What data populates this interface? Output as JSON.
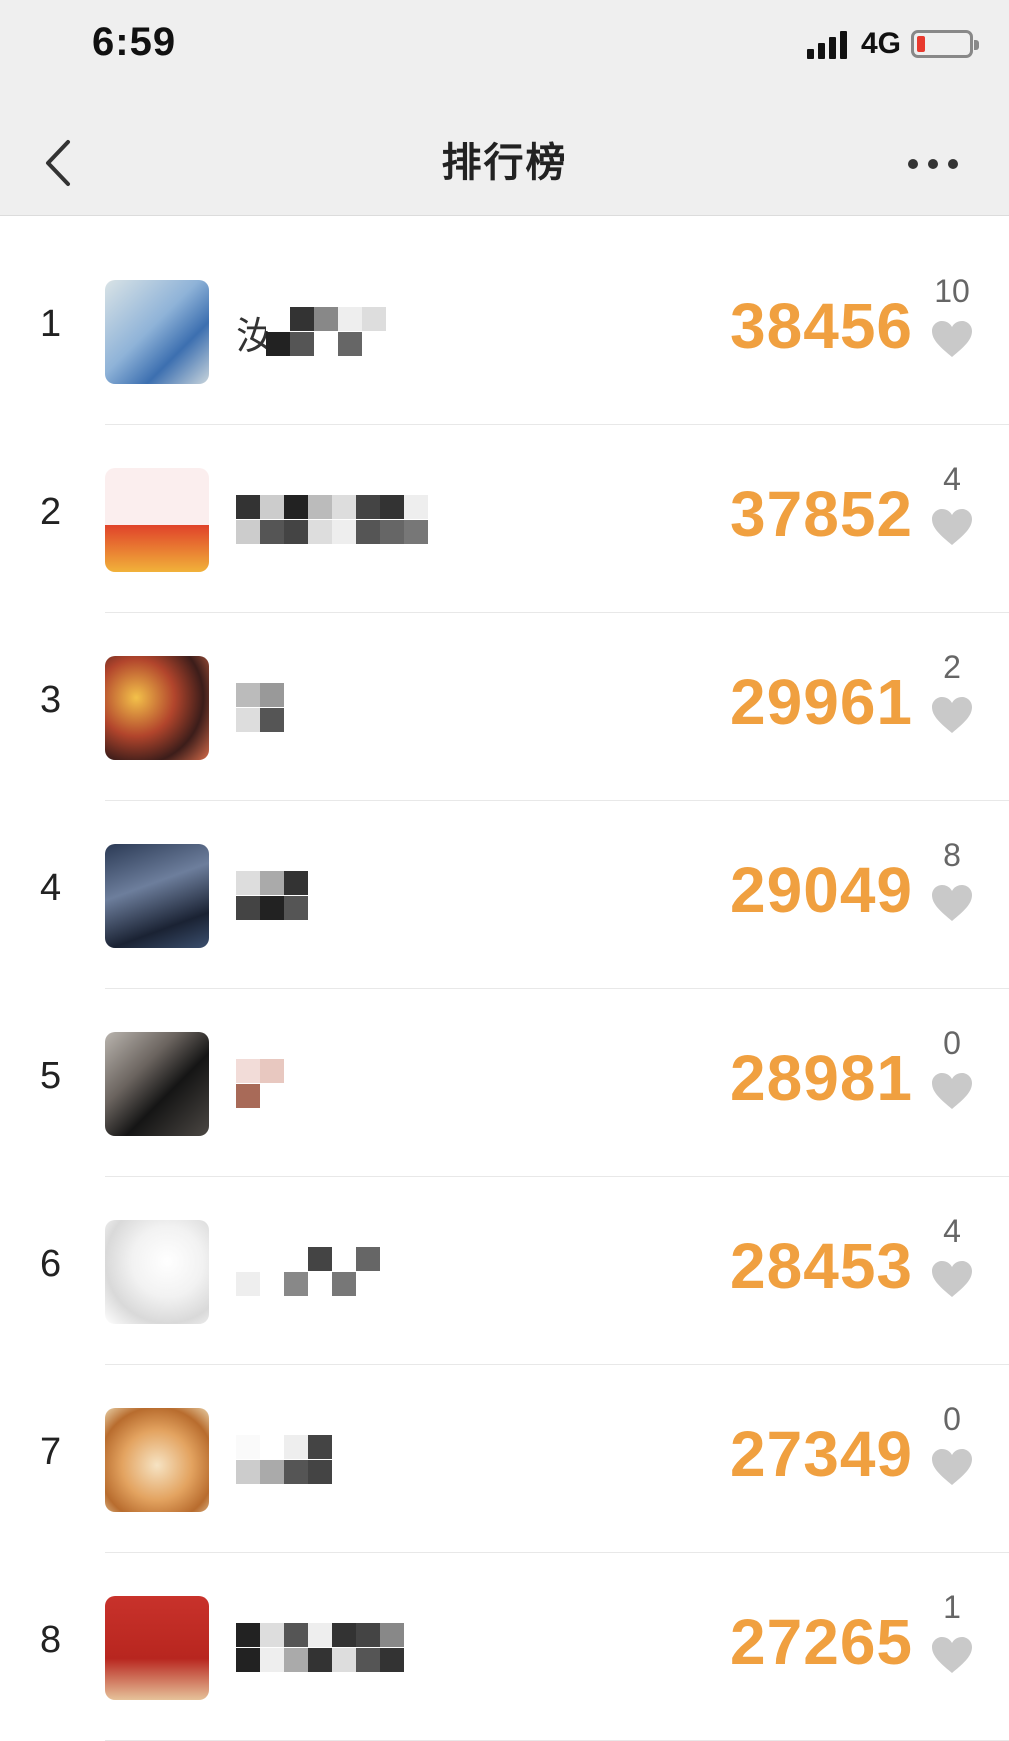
{
  "status_bar": {
    "time": "6:59",
    "network": "4G",
    "battery_level": 0.1,
    "battery_color": "#e83a2e"
  },
  "nav": {
    "title": "排行榜",
    "back_icon": "chevron-left-icon",
    "more_icon": "ellipsis-icon"
  },
  "colors": {
    "score": "#f0a040",
    "heart": "#c9c9c9"
  },
  "rows": [
    {
      "rank": "1",
      "name": "汝",
      "score": "38456",
      "likes": "10",
      "avatar": "cartoon-blue-creature-avatar"
    },
    {
      "rank": "2",
      "name": "",
      "score": "37852",
      "likes": "4",
      "avatar": "anime-boy-glasses-avatar"
    },
    {
      "rank": "3",
      "name": "",
      "score": "29961",
      "likes": "2",
      "avatar": "anime-girl-avatar"
    },
    {
      "rank": "4",
      "name": "",
      "score": "29049",
      "likes": "8",
      "avatar": "man-night-photo-avatar"
    },
    {
      "rank": "5",
      "name": "",
      "score": "28981",
      "likes": "0",
      "avatar": "man-black-sweater-avatar"
    },
    {
      "rank": "6",
      "name": "",
      "score": "28453",
      "likes": "4",
      "avatar": "hand-sketch-avatar"
    },
    {
      "rank": "7",
      "name": "",
      "score": "27349",
      "likes": "0",
      "avatar": "shiba-dog-avatar"
    },
    {
      "rank": "8",
      "name": "",
      "score": "27265",
      "likes": "1",
      "avatar": "red-festive-avatar"
    }
  ]
}
